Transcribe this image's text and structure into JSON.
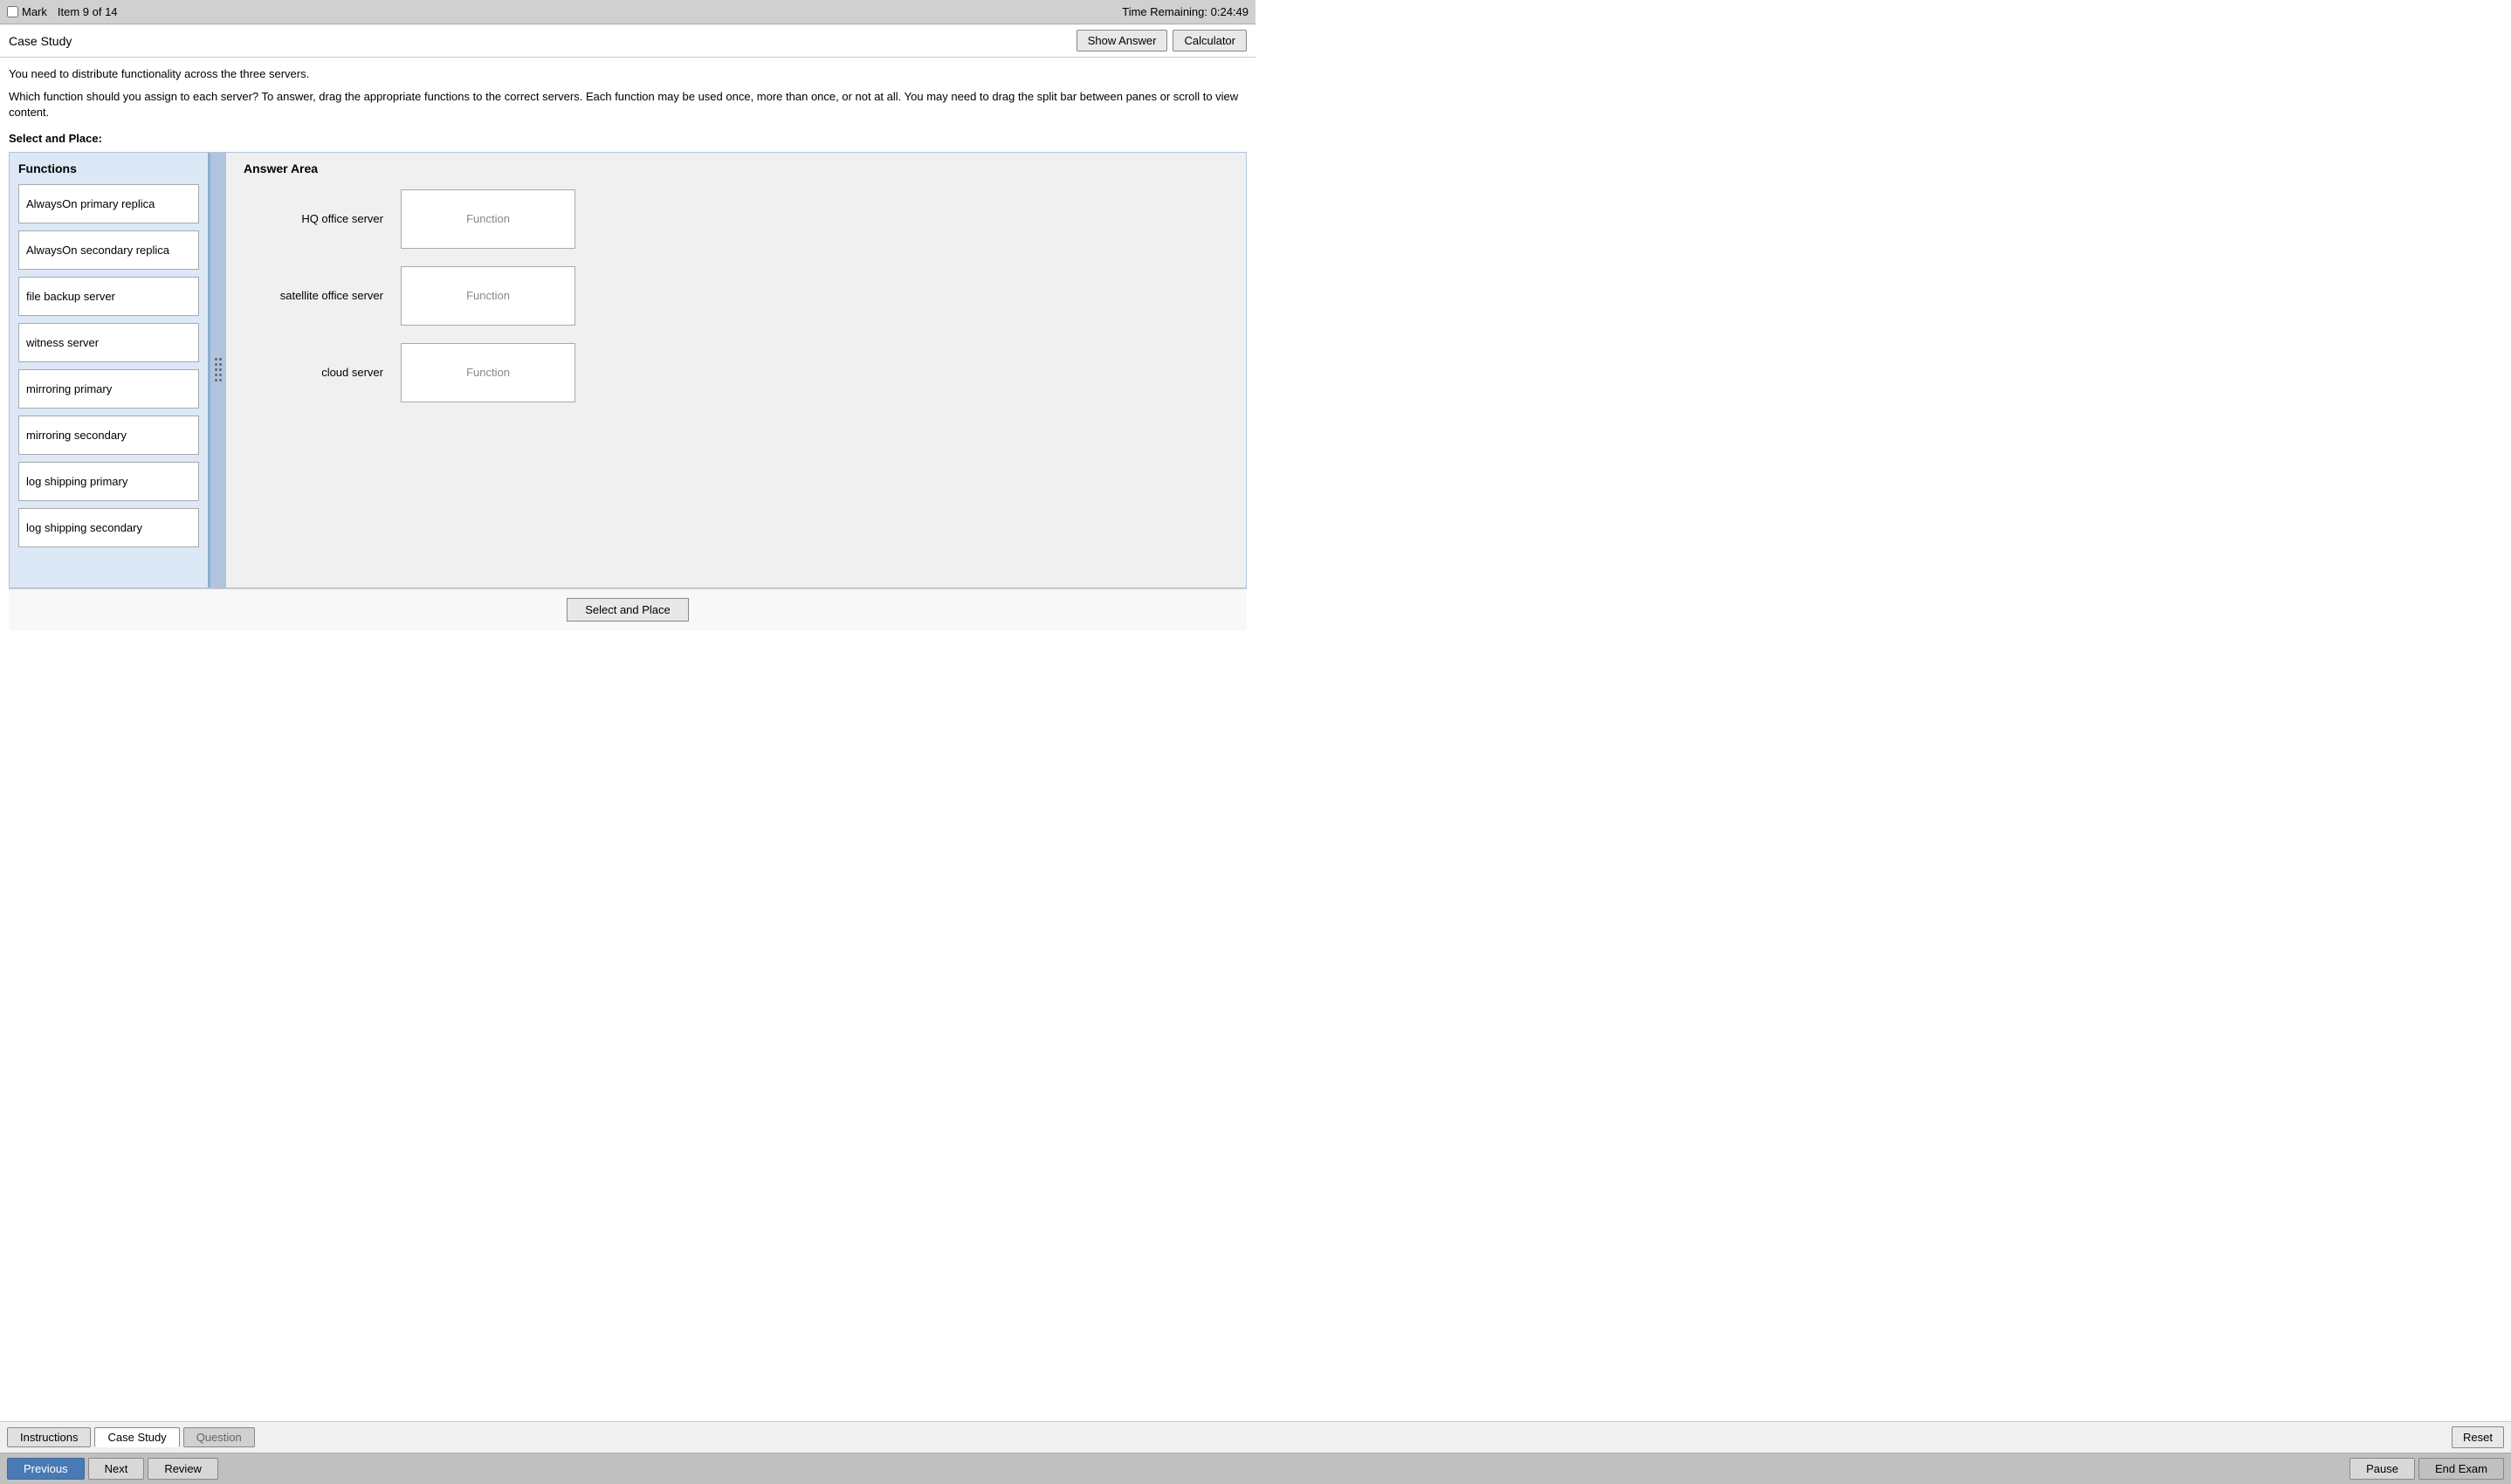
{
  "topBar": {
    "markLabel": "Mark",
    "itemInfo": "Item 9 of 14",
    "timeLabel": "Time Remaining: 0:24:49"
  },
  "header": {
    "caseStudyLabel": "Case Study",
    "showAnswerBtn": "Show Answer",
    "calculatorBtn": "Calculator"
  },
  "content": {
    "instructionText": "You need to distribute functionality across the three servers.",
    "questionText": "Which function should you assign to each server? To answer, drag the appropriate functions to the correct servers. Each function may be used once, more than once, or not at all. You may need to drag the split bar between panes or scroll to view content.",
    "selectAndPlaceLabel": "Select and Place:"
  },
  "functionsPanel": {
    "title": "Functions",
    "items": [
      {
        "label": "AlwaysOn primary replica"
      },
      {
        "label": "AlwaysOn secondary replica"
      },
      {
        "label": "file backup server"
      },
      {
        "label": "witness server"
      },
      {
        "label": "mirroring primary"
      },
      {
        "label": "mirroring secondary"
      },
      {
        "label": "log shipping primary"
      },
      {
        "label": "log shipping secondary"
      }
    ]
  },
  "answerPanel": {
    "title": "Answer Area",
    "rows": [
      {
        "serverLabel": "HQ office server",
        "dropLabel": "Function"
      },
      {
        "serverLabel": "satellite office server",
        "dropLabel": "Function"
      },
      {
        "serverLabel": "cloud server",
        "dropLabel": "Function"
      }
    ]
  },
  "selectPlaceBtn": "Select and Place",
  "bottomTabs": {
    "instructionsTab": "Instructions",
    "caseStudyTab": "Case Study",
    "questionTab": "Question",
    "resetBtn": "Reset"
  },
  "navBar": {
    "previousBtn": "Previous",
    "nextBtn": "Next",
    "reviewBtn": "Review",
    "pauseBtn": "Pause",
    "endExamBtn": "End Exam"
  }
}
